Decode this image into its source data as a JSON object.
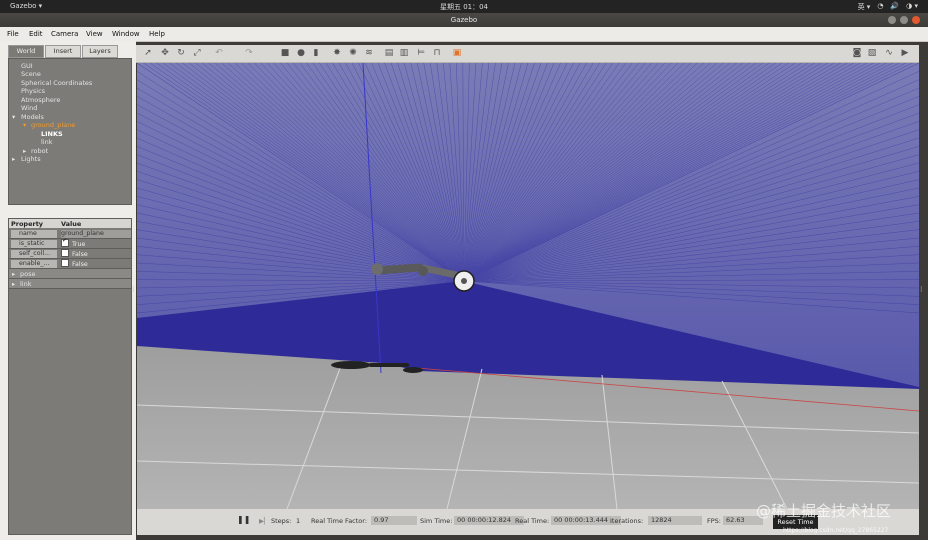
{
  "system_bar": {
    "app_name": "Gazebo ▾",
    "clock": "星期五 01：04",
    "tray": [
      "英 ▾",
      "◔",
      "🔊",
      "◑ ▾"
    ]
  },
  "window": {
    "title": "Gazebo"
  },
  "menu": [
    "File",
    "Edit",
    "Camera",
    "View",
    "Window",
    "Help"
  ],
  "left_panel": {
    "tabs": [
      "World",
      "Insert",
      "Layers"
    ],
    "active_tab": "World",
    "tree": [
      "GUI",
      "Scene",
      "Spherical Coordinates",
      "Physics",
      "Atmosphere",
      "Wind",
      "Models",
      "ground_plane",
      "LINKS",
      "link",
      "robot",
      "Lights"
    ],
    "properties": {
      "header": [
        "Property",
        "Value"
      ],
      "rows": [
        {
          "name": "name",
          "value": "ground_plane",
          "type": "field"
        },
        {
          "name": "is_static",
          "value": "True",
          "type": "check",
          "checked": true
        },
        {
          "name": "self_coll...",
          "value": "False",
          "type": "check",
          "checked": false
        },
        {
          "name": "enable_...",
          "value": "False",
          "type": "check",
          "checked": false
        },
        {
          "name": "pose",
          "value": "",
          "type": "group"
        },
        {
          "name": "link",
          "value": "",
          "type": "group"
        }
      ]
    }
  },
  "toolbar": {
    "tools": [
      "select-icon",
      "translate-icon",
      "rotate-icon",
      "scale-icon",
      "undo-icon",
      "redo-icon",
      "box-icon",
      "sphere-icon",
      "cylinder-icon",
      "point-light-icon",
      "spot-light-icon",
      "directional-light-icon",
      "copy-icon",
      "paste-icon",
      "align-icon",
      "snap-icon",
      "change-view-icon"
    ],
    "right_tools": [
      "screenshot-icon",
      "log-icon",
      "plot-icon",
      "video-icon"
    ]
  },
  "status": {
    "pause": "❚❚",
    "steps_label": "Steps:",
    "steps_value": "1",
    "rtf_label": "Real Time Factor:",
    "rtf_value": "0.97",
    "sim_time_label": "Sim Time:",
    "sim_time_value": "00 00:00:12.824",
    "real_time_label": "Real Time:",
    "real_time_value": "00 00:00:13.444",
    "iterations_label": "Iterations:",
    "iterations_value": "12824",
    "fps_label": "FPS:",
    "fps_value": "62.63",
    "reset_label": "Reset Time"
  },
  "watermark": {
    "main": "@稀土掘金技术社区",
    "sub": "https://blog.csdn.net/qq_27865227"
  },
  "colors": {
    "sky": "#d4d4d4",
    "laser": "#2d2a9c",
    "ground": "#a8a8a8",
    "accent": "#f39a2c"
  }
}
